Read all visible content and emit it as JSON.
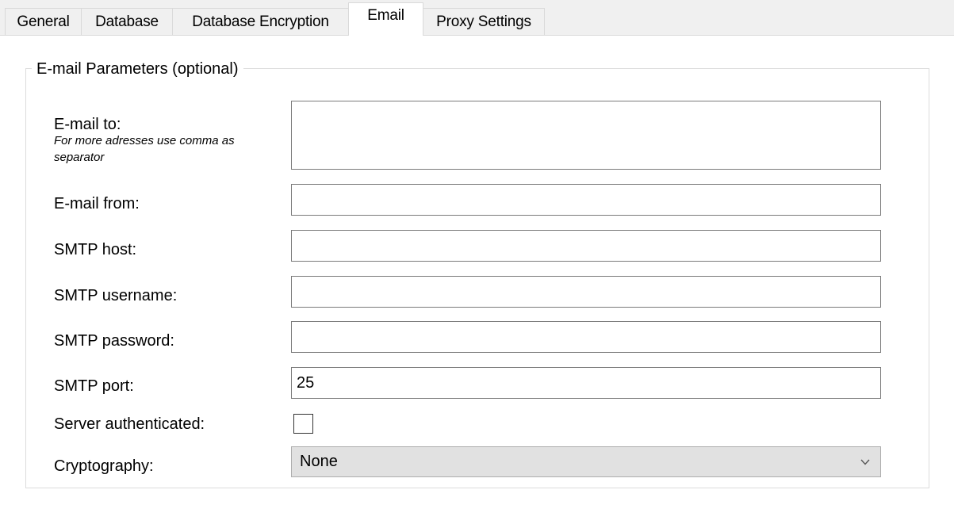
{
  "tabs": [
    {
      "label": "General"
    },
    {
      "label": "Database"
    },
    {
      "label": "Database Encryption"
    },
    {
      "label": "Email",
      "active": true
    },
    {
      "label": "Proxy Settings"
    }
  ],
  "group": {
    "legend": "E-mail Parameters (optional)"
  },
  "fields": {
    "email_to": {
      "label": "E-mail to:",
      "hint": "For more adresses use comma as separator",
      "value": ""
    },
    "email_from": {
      "label": "E-mail from:",
      "value": ""
    },
    "smtp_host": {
      "label": "SMTP host:",
      "value": ""
    },
    "smtp_username": {
      "label": "SMTP username:",
      "value": ""
    },
    "smtp_password": {
      "label": "SMTP password:",
      "value": ""
    },
    "smtp_port": {
      "label": "SMTP port:",
      "value": "25"
    },
    "server_authenticated": {
      "label": "Server authenticated:",
      "checked": false
    },
    "cryptography": {
      "label": "Cryptography:",
      "selected": "None"
    }
  }
}
